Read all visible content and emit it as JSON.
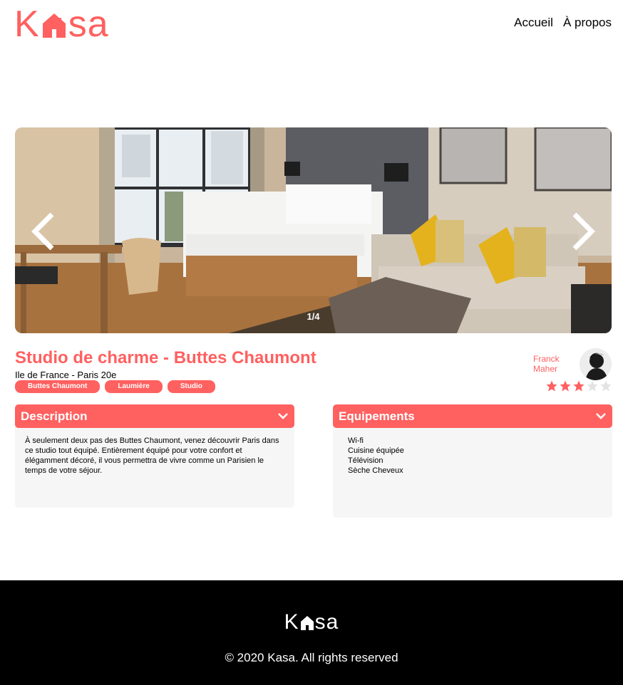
{
  "brand": {
    "logo_left": "K",
    "logo_right": "sa",
    "logo_icon": "house-icon",
    "color": "#FF6060"
  },
  "nav": {
    "home": "Accueil",
    "about": "À propos"
  },
  "carousel": {
    "counter": "1/4",
    "prev_icon": "chevron-left-icon",
    "next_icon": "chevron-right-icon"
  },
  "listing": {
    "title": "Studio de charme - Buttes Chaumont",
    "location": "Ile de France - Paris 20e",
    "tags": [
      "Buttes Chaumont",
      "Laumière",
      "Studio"
    ],
    "host": {
      "first_name": "Franck",
      "last_name": "Maher"
    },
    "rating": 3,
    "rating_max": 5
  },
  "description": {
    "title": "Description",
    "text": "À seulement deux pas des Buttes Chaumont, venez découvrir Paris dans ce studio tout équipé. Entièrement équipé pour votre confort et élégamment décoré, il vous permettra de vivre comme un Parisien le temps de votre séjour."
  },
  "equipments": {
    "title": "Equipements",
    "items": [
      "Wi-fi",
      "Cuisine équipée",
      "Télévision",
      "Sèche Cheveux"
    ]
  },
  "footer": {
    "logo_left": "K",
    "logo_right": "sa",
    "copyright": "© 2020 Kasa. All rights reserved"
  },
  "colors": {
    "accent": "#FF6060",
    "panel": "#F6F6F6",
    "footer_bg": "#000000"
  }
}
